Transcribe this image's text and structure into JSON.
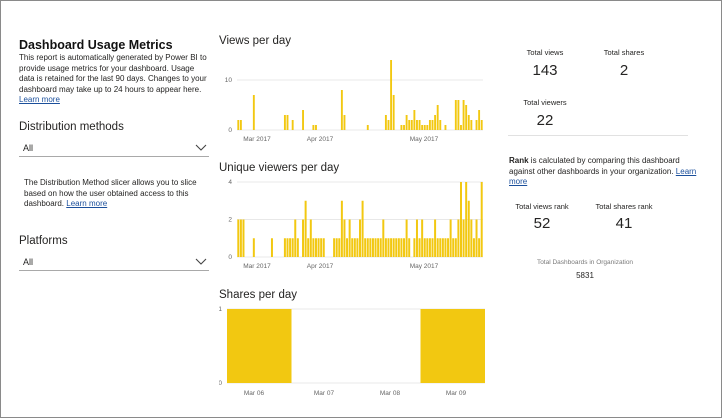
{
  "left": {
    "title": "Dashboard Usage Metrics",
    "description": "This report is automatically generated by Power BI to provide usage metrics for your dashboard. Usage data is retained for the last 90 days. Changes to your dashboard may take up to 24 hours to appear here.",
    "learn_more": "Learn more",
    "distribution_heading": "Distribution methods",
    "distribution_value": "All",
    "distribution_note": "The Distribution Method slicer allows you to slice based on how the user obtained access to this dashboard.",
    "distribution_learn_more": "Learn more",
    "platforms_heading": "Platforms",
    "platforms_value": "All"
  },
  "kpis": {
    "total_views_label": "Total views",
    "total_views": "143",
    "total_shares_label": "Total shares",
    "total_shares": "2",
    "total_viewers_label": "Total viewers",
    "total_viewers": "22",
    "rank_word": "Rank",
    "rank_text": " is calculated by comparing this dashboard against other dashboards in your organization.",
    "rank_learn_more": "Learn more",
    "total_views_rank_label": "Total views rank",
    "total_views_rank": "52",
    "total_shares_rank_label": "Total shares rank",
    "total_shares_rank": "41",
    "total_dashboards_label": "Total Dashboards in Organization",
    "total_dashboards": "5831"
  },
  "colors": {
    "bar": "#f2c811",
    "link": "#1b4f9b"
  },
  "chart_data": [
    {
      "type": "bar",
      "title": "Views per day",
      "ylim": [
        0,
        14
      ],
      "yticks": [
        0,
        10
      ],
      "xticks": [
        "Mar 2017",
        "Apr 2017",
        "May 2017"
      ],
      "values": [
        2,
        2,
        0,
        0,
        0,
        0,
        7,
        0,
        0,
        0,
        0,
        0,
        0,
        0,
        0,
        0,
        0,
        0,
        3,
        3,
        0,
        2,
        0,
        0,
        0,
        4,
        0,
        0,
        0,
        1,
        1,
        0,
        0,
        0,
        0,
        0,
        0,
        0,
        0,
        0,
        8,
        3,
        0,
        0,
        0,
        0,
        0,
        0,
        0,
        0,
        1,
        0,
        0,
        0,
        0,
        0,
        0,
        3,
        2,
        14,
        7,
        0,
        0,
        1,
        1,
        3,
        2,
        2,
        4,
        2,
        2,
        1,
        1,
        1,
        2,
        2,
        3,
        5,
        2,
        0,
        1,
        0,
        0,
        0,
        6,
        6,
        1,
        6,
        5,
        3,
        2,
        0,
        2,
        4,
        2
      ]
    },
    {
      "type": "bar",
      "title": "Unique viewers per day",
      "ylim": [
        0,
        4
      ],
      "yticks": [
        0,
        2,
        4
      ],
      "xticks": [
        "Mar 2017",
        "Apr 2017",
        "May 2017"
      ],
      "values": [
        2,
        2,
        2,
        0,
        0,
        0,
        1,
        0,
        0,
        0,
        0,
        0,
        0,
        1,
        0,
        0,
        0,
        0,
        1,
        1,
        1,
        1,
        2,
        1,
        0,
        2,
        3,
        1,
        2,
        1,
        1,
        1,
        1,
        1,
        0,
        0,
        0,
        1,
        1,
        1,
        3,
        2,
        1,
        2,
        1,
        1,
        1,
        2,
        3,
        1,
        1,
        1,
        1,
        1,
        1,
        1,
        2,
        1,
        1,
        1,
        1,
        1,
        1,
        1,
        1,
        2,
        1,
        0,
        1,
        2,
        1,
        2,
        1,
        1,
        1,
        1,
        2,
        1,
        1,
        1,
        1,
        1,
        2,
        1,
        1,
        2,
        4,
        2,
        4,
        3,
        2,
        1,
        2,
        1,
        4
      ]
    },
    {
      "type": "bar",
      "title": "Shares per day",
      "ylim": [
        0,
        1
      ],
      "yticks": [
        0,
        1
      ],
      "xticks": [
        "Mar 06",
        "Mar 07",
        "Mar 08",
        "Mar 09"
      ],
      "values": [
        1,
        0,
        0,
        1
      ]
    }
  ]
}
